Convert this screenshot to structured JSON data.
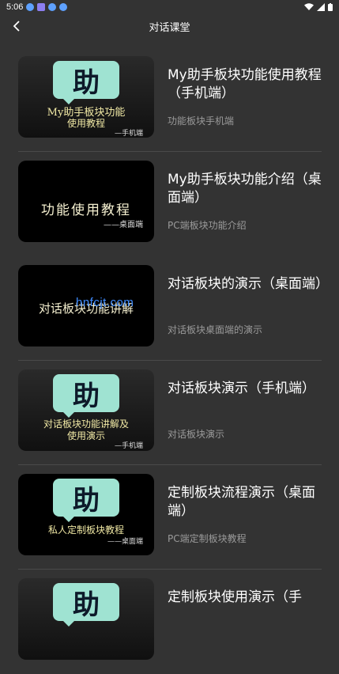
{
  "status_bar": {
    "time": "5:06"
  },
  "header": {
    "title": "对话课堂"
  },
  "items": [
    {
      "title": "My助手板块功能使用教程（手机端）",
      "subtitle": "功能板块手机端",
      "thumb": {
        "logo": "助",
        "line1": "My助手板块功能",
        "line2": "使用教程",
        "sub": "—手机端"
      }
    },
    {
      "title": "My助手板块功能介绍（桌面端）",
      "subtitle": "PC端板块功能介绍",
      "thumb": {
        "big": "功能使用教程",
        "sub": "——桌面端"
      }
    },
    {
      "title": "对话板块的演示（桌面端）",
      "subtitle": "对话板块桌面端的演示",
      "thumb": {
        "big": "对话板块功能讲解"
      }
    },
    {
      "title": "对话板块演示（手机端）",
      "subtitle": "对话板块演示",
      "thumb": {
        "logo": "助",
        "line1": "对话板块功能讲解及",
        "line2": "使用演示",
        "sub": "—手机端"
      }
    },
    {
      "title": "定制板块流程演示（桌面端）",
      "subtitle": "PC端定制板块教程",
      "thumb": {
        "logo": "助",
        "line1": "私人定制板块教程",
        "sub": "——桌面端"
      }
    },
    {
      "title": "定制板块使用演示（手",
      "subtitle": "",
      "thumb": {
        "logo": "助"
      }
    }
  ],
  "watermark": "hnfcjt.com"
}
